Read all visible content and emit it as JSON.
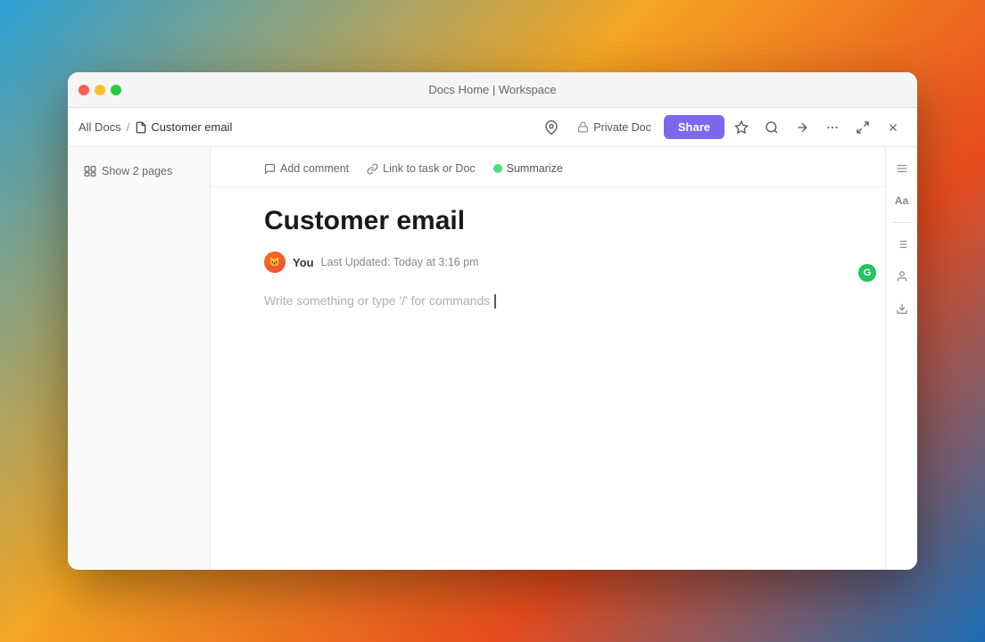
{
  "titlebar": {
    "title": "Docs Home | Workspace"
  },
  "toolbar": {
    "breadcrumb": {
      "parent": "All Docs",
      "separator": "/",
      "current": "Customer email"
    },
    "privacy_label": "Private Doc",
    "share_label": "Share"
  },
  "sidebar": {
    "show_pages_label": "Show 2 pages"
  },
  "doc_toolbar": {
    "add_comment": "Add comment",
    "link_task": "Link to task or Doc",
    "summarize": "Summarize"
  },
  "document": {
    "title": "Customer email",
    "author": "You",
    "updated_label": "Last Updated: Today at 3:16 pm",
    "placeholder": "Write something or type '/' for commands"
  },
  "icons": {
    "close": "✕",
    "minimize": "–",
    "maximize": "+",
    "doc": "📄",
    "bookmark": "☆",
    "search": "⌕",
    "export": "↗",
    "more": "···",
    "collapse": "⤡",
    "close_window": "✕",
    "lock": "🔒",
    "comment": "💬",
    "link": "🔗",
    "sparkle": "✦",
    "pages": "⊞",
    "format": "Aa",
    "divider1": "⋮",
    "person": "👤",
    "download": "⬇"
  },
  "colors": {
    "share_btn_bg": "#7b68ee",
    "privacy_lock": "#888",
    "summarize_dot": "#4ade80",
    "green_circle": "#22c55e"
  }
}
